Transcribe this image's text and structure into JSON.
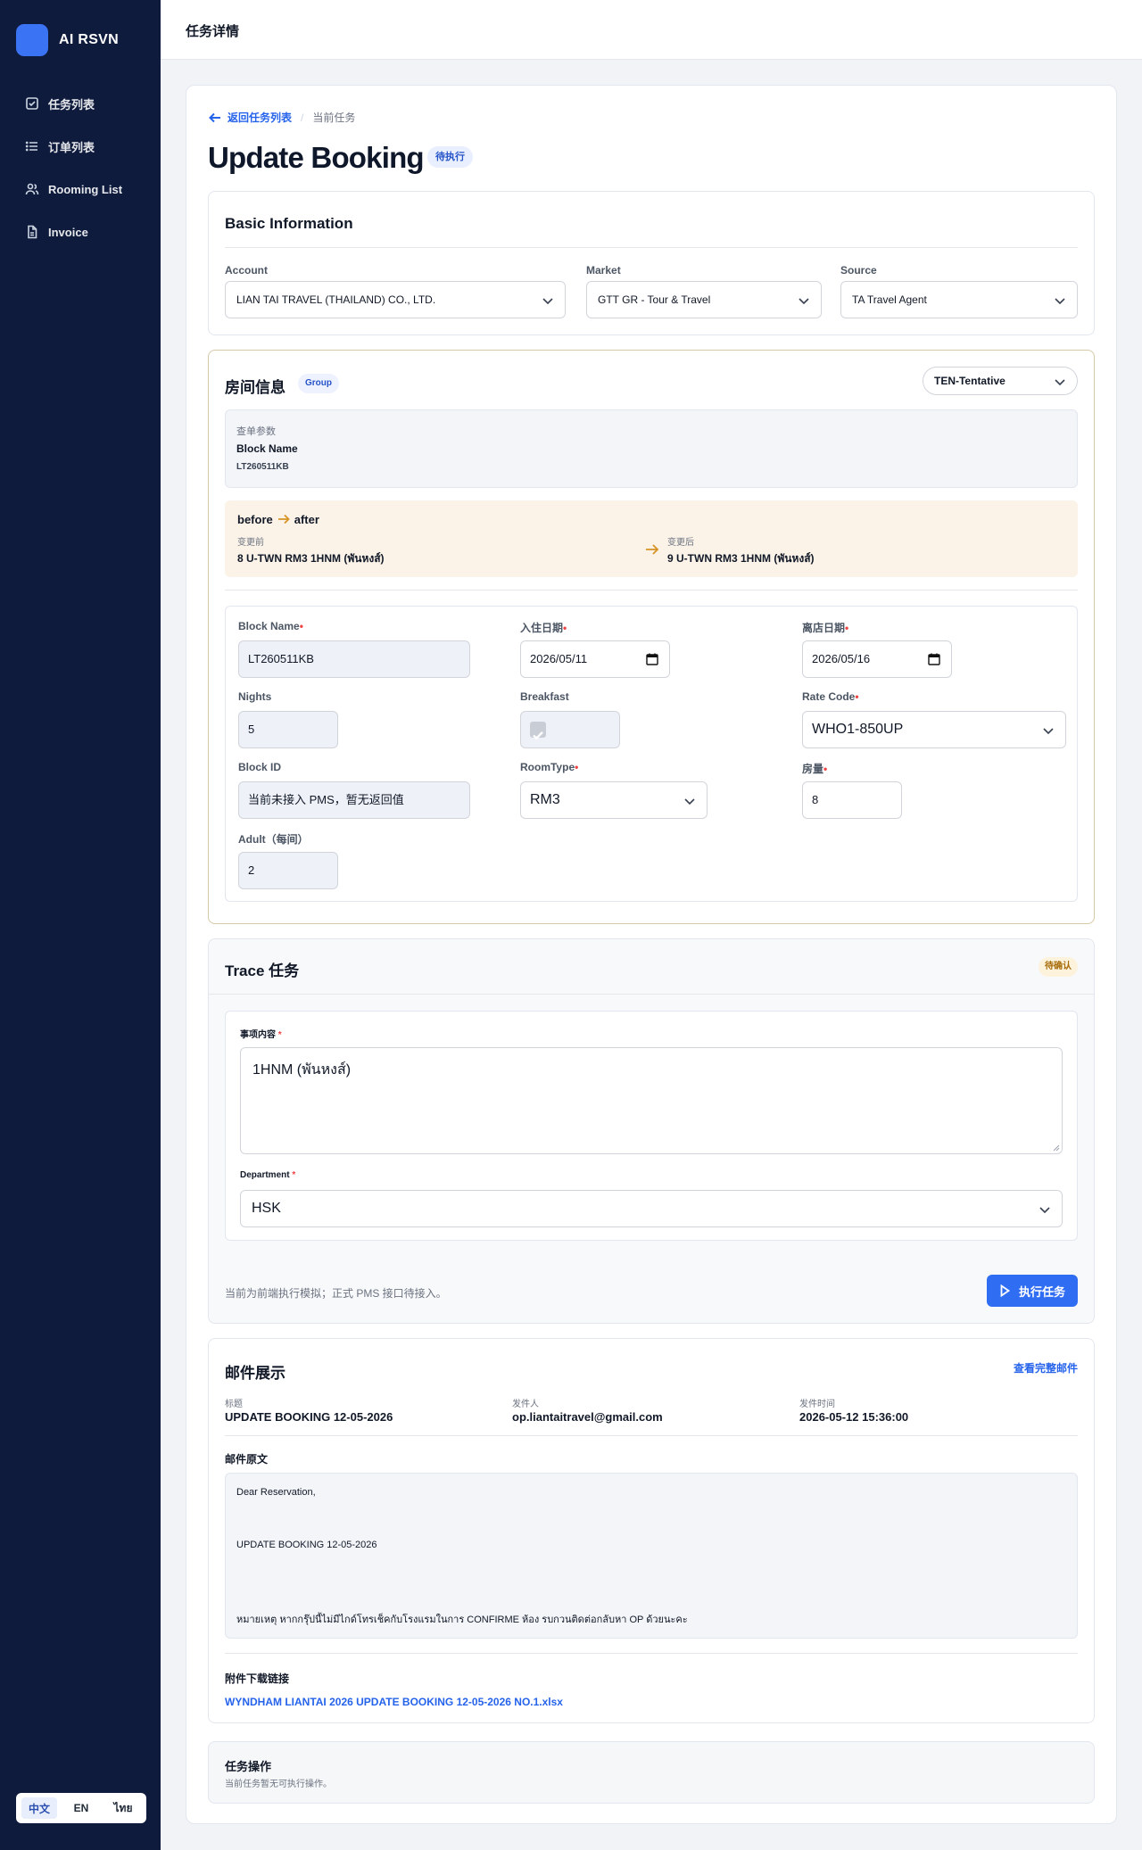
{
  "app": {
    "brand": "AI RSVN",
    "page_title": "任务详情"
  },
  "sidebar": {
    "items": [
      {
        "label": "任务列表",
        "icon": "checkbox-icon"
      },
      {
        "label": "订单列表",
        "icon": "list-icon"
      },
      {
        "label": "Rooming List",
        "icon": "users-icon"
      },
      {
        "label": "Invoice",
        "icon": "document-icon"
      }
    ],
    "languages": [
      {
        "label": "中文",
        "active": true
      },
      {
        "label": "EN",
        "active": false
      },
      {
        "label": "ไทย",
        "active": false
      }
    ]
  },
  "breadcrumb": {
    "back": "返回任务列表",
    "separator": "/",
    "current": "当前任务"
  },
  "task": {
    "title": "Update Booking",
    "status": "待执行"
  },
  "basic_info": {
    "title": "Basic Information",
    "account_label": "Account",
    "account_value": "LIAN TAI TRAVEL (THAILAND) CO., LTD.",
    "market_label": "Market",
    "market_value": "GTT  GR - Tour & Travel",
    "source_label": "Source",
    "source_value": "TA  Travel Agent"
  },
  "room_info": {
    "title": "房间信息",
    "tag": "Group",
    "status_select": "TEN-Tentative",
    "query": {
      "label": "查单参数",
      "name": "Block Name",
      "value": "LT260511KB"
    },
    "diff": {
      "before_word": "before",
      "after_word": "after",
      "before_label": "变更前",
      "before_value": "8 U-TWN RM3 1HNM (พันหงส์)",
      "after_label": "变更后",
      "after_value": "9 U-TWN RM3 1HNM (พันหงส์)"
    },
    "fields": {
      "block_name_label": "Block Name",
      "block_name_value": "LT260511KB",
      "checkin_label": "入住日期",
      "checkin_value": "2026/05/11",
      "checkout_label": "离店日期",
      "checkout_value": "2026/05/16",
      "nights_label": "Nights",
      "nights_value": "5",
      "breakfast_label": "Breakfast",
      "breakfast_checked": true,
      "rate_code_label": "Rate Code",
      "rate_code_value": "WHO1-850UP",
      "block_id_label": "Block ID",
      "block_id_value": "当前未接入 PMS，暂无返回值",
      "roomtype_label": "RoomType",
      "roomtype_value": "RM3",
      "rooms_label": "房量",
      "rooms_value": "8",
      "adult_label": "Adult（每间）",
      "adult_value": "2",
      "required_mark": "•"
    }
  },
  "trace": {
    "title": "Trace 任务",
    "status": "待确认",
    "content_label": "事项内容",
    "content_value": "1HNM (พันหงส์)",
    "department_label": "Department",
    "department_value": "HSK",
    "required_mark": "*",
    "note": "当前为前端执行模拟；正式 PMS 接口待接入。",
    "execute_button": "执行任务"
  },
  "mail": {
    "title": "邮件展示",
    "view_full": "查看完整邮件",
    "subject_label": "标题",
    "subject_value": "UPDATE BOOKING 12-05-2026",
    "sender_label": "发件人",
    "sender_value": "op.liantaitravel@gmail.com",
    "time_label": "发件时间",
    "time_value": "2026-05-12 15:36:00",
    "body_label": "邮件原文",
    "body_lines": [
      "Dear Reservation,",
      "UPDATE BOOKING 12-05-2026",
      "หมายเหตุ หากกรุ๊ปนี้ไม่มีไกด์โทรเช็คกับโรงแรมในการ CONFIRME ห้อง รบกวนติดต่อกลับหา OP ด้วยนะคะ"
    ],
    "attachments_label": "附件下载链接",
    "attachment": "WYNDHAM LIANTAI 2026 UPDATE BOOKING 12-05-2026 NO.1.xlsx"
  },
  "operations": {
    "title": "任务操作",
    "note": "当前任务暂无可执行操作。"
  }
}
